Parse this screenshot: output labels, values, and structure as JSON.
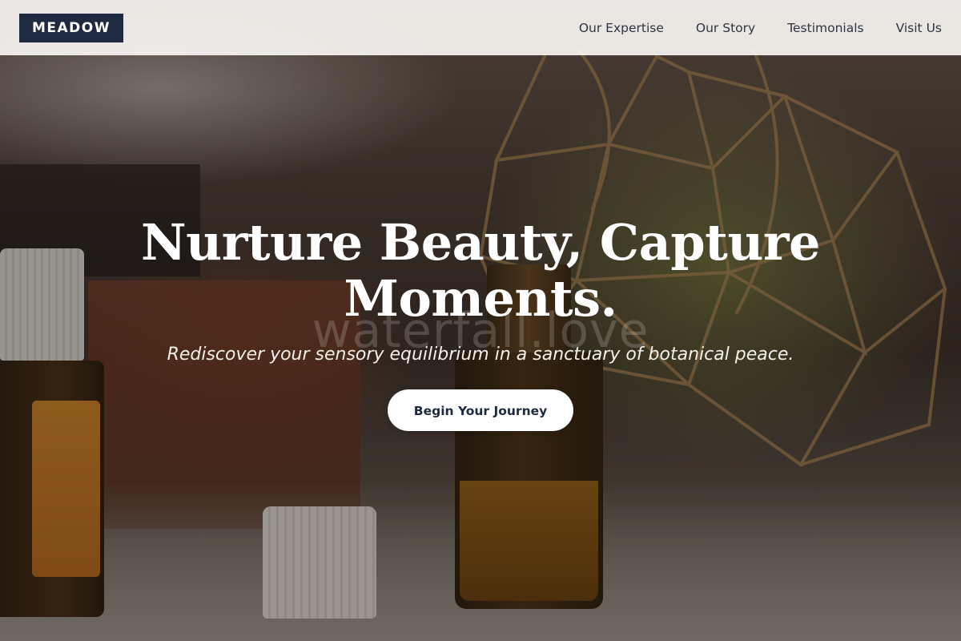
{
  "header": {
    "logo": "MEADOW",
    "nav": [
      {
        "label": "Our Expertise"
      },
      {
        "label": "Our Story"
      },
      {
        "label": "Testimonials"
      },
      {
        "label": "Visit Us"
      }
    ]
  },
  "hero": {
    "title_line1": "Nurture Beauty, Capture",
    "title_line2": "Moments.",
    "subtitle": "Rediscover your sensory equilibrium in a sanctuary of botanical peace.",
    "cta_label": "Begin Your Journey",
    "watermark": "waterfall.love"
  },
  "colors": {
    "brand_navy": "#1e2a3f",
    "header_bg": "#f6f4f1",
    "cta_bg": "#ffffff"
  }
}
